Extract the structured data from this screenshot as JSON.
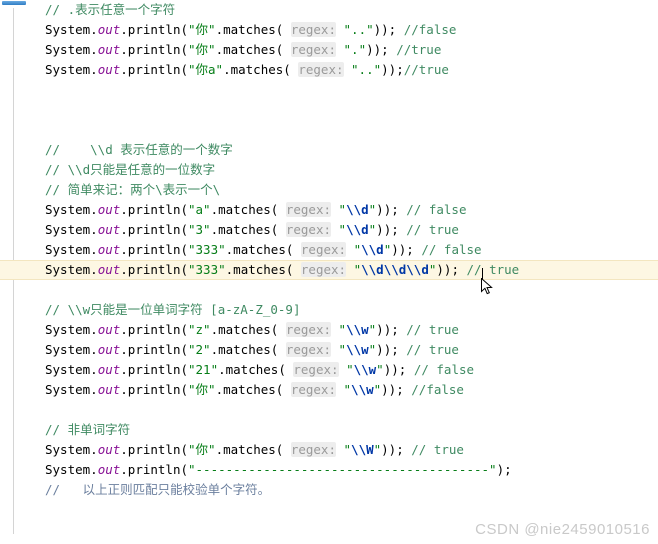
{
  "app": {
    "kind": "code-editor",
    "language": "Java",
    "background_color": "#ffffff",
    "highlight_line_color": "#fdf7e3",
    "accent_color": "#2f7dc4"
  },
  "colors": {
    "plain": "#000000",
    "field": "#871094",
    "string": "#067d17",
    "regex_escape": "#0037a6",
    "comment": "#3f8a62",
    "comment_blue": "#6b7f9e",
    "param_hint": "#9a9a9a",
    "param_hint_bg": "#ededed",
    "gutter_divider": "#d4d4d4",
    "watermark": "#c9c9c9"
  },
  "editor": {
    "caret": {
      "visible": true,
      "line_index": 13
    },
    "mouse_pointer": {
      "visible": true,
      "glyph": "arrow-cursor"
    },
    "lines": [
      {
        "highlighted": false,
        "tokens": [
          {
            "t": "comment",
            "s": "// .表示任意一个字符"
          }
        ]
      },
      {
        "highlighted": false,
        "tokens": [
          {
            "t": "plain",
            "s": "System."
          },
          {
            "t": "field",
            "s": "out"
          },
          {
            "t": "plain",
            "s": ".println("
          },
          {
            "t": "string",
            "s": "\"你\""
          },
          {
            "t": "plain",
            "s": ".matches( "
          },
          {
            "t": "hint",
            "s": "regex:"
          },
          {
            "t": "plain",
            "s": " "
          },
          {
            "t": "string",
            "s": "\"..\""
          },
          {
            "t": "plain",
            "s": ")); "
          },
          {
            "t": "comment",
            "s": "//false"
          }
        ]
      },
      {
        "highlighted": false,
        "tokens": [
          {
            "t": "plain",
            "s": "System."
          },
          {
            "t": "field",
            "s": "out"
          },
          {
            "t": "plain",
            "s": ".println("
          },
          {
            "t": "string",
            "s": "\"你\""
          },
          {
            "t": "plain",
            "s": ".matches( "
          },
          {
            "t": "hint",
            "s": "regex:"
          },
          {
            "t": "plain",
            "s": " "
          },
          {
            "t": "string",
            "s": "\".\""
          },
          {
            "t": "plain",
            "s": ")); "
          },
          {
            "t": "comment",
            "s": "//true"
          }
        ]
      },
      {
        "highlighted": false,
        "tokens": [
          {
            "t": "plain",
            "s": "System."
          },
          {
            "t": "field",
            "s": "out"
          },
          {
            "t": "plain",
            "s": ".println("
          },
          {
            "t": "string",
            "s": "\"你a\""
          },
          {
            "t": "plain",
            "s": ".matches( "
          },
          {
            "t": "hint",
            "s": "regex:"
          },
          {
            "t": "plain",
            "s": " "
          },
          {
            "t": "string",
            "s": "\"..\""
          },
          {
            "t": "plain",
            "s": "));"
          },
          {
            "t": "comment",
            "s": "//true"
          }
        ]
      },
      {
        "highlighted": false,
        "tokens": []
      },
      {
        "highlighted": false,
        "tokens": []
      },
      {
        "highlighted": false,
        "tokens": []
      },
      {
        "highlighted": false,
        "tokens": [
          {
            "t": "comment",
            "s": "//    \\\\d 表示任意的一个数字"
          }
        ]
      },
      {
        "highlighted": false,
        "tokens": [
          {
            "t": "comment",
            "s": "// \\\\d只能是任意的一位数字"
          }
        ]
      },
      {
        "highlighted": false,
        "tokens": [
          {
            "t": "comment",
            "s": "// 简单来记：两个\\表示一个\\"
          }
        ]
      },
      {
        "highlighted": false,
        "tokens": [
          {
            "t": "plain",
            "s": "System."
          },
          {
            "t": "field",
            "s": "out"
          },
          {
            "t": "plain",
            "s": ".println("
          },
          {
            "t": "string",
            "s": "\"a\""
          },
          {
            "t": "plain",
            "s": ".matches( "
          },
          {
            "t": "hint",
            "s": "regex:"
          },
          {
            "t": "plain",
            "s": " "
          },
          {
            "t": "string",
            "s": "\""
          },
          {
            "t": "regex",
            "s": "\\\\d"
          },
          {
            "t": "string",
            "s": "\""
          },
          {
            "t": "plain",
            "s": ")); "
          },
          {
            "t": "comment",
            "s": "// false"
          }
        ]
      },
      {
        "highlighted": false,
        "tokens": [
          {
            "t": "plain",
            "s": "System."
          },
          {
            "t": "field",
            "s": "out"
          },
          {
            "t": "plain",
            "s": ".println("
          },
          {
            "t": "string",
            "s": "\"3\""
          },
          {
            "t": "plain",
            "s": ".matches( "
          },
          {
            "t": "hint",
            "s": "regex:"
          },
          {
            "t": "plain",
            "s": " "
          },
          {
            "t": "string",
            "s": "\""
          },
          {
            "t": "regex",
            "s": "\\\\d"
          },
          {
            "t": "string",
            "s": "\""
          },
          {
            "t": "plain",
            "s": ")); "
          },
          {
            "t": "comment",
            "s": "// true"
          }
        ]
      },
      {
        "highlighted": false,
        "tokens": [
          {
            "t": "plain",
            "s": "System."
          },
          {
            "t": "field",
            "s": "out"
          },
          {
            "t": "plain",
            "s": ".println("
          },
          {
            "t": "string",
            "s": "\"333\""
          },
          {
            "t": "plain",
            "s": ".matches( "
          },
          {
            "t": "hint",
            "s": "regex:"
          },
          {
            "t": "plain",
            "s": " "
          },
          {
            "t": "string",
            "s": "\""
          },
          {
            "t": "regex",
            "s": "\\\\d"
          },
          {
            "t": "string",
            "s": "\""
          },
          {
            "t": "plain",
            "s": ")); "
          },
          {
            "t": "comment",
            "s": "// false"
          }
        ]
      },
      {
        "highlighted": true,
        "tokens": [
          {
            "t": "plain",
            "s": "System."
          },
          {
            "t": "field",
            "s": "out"
          },
          {
            "t": "plain",
            "s": ".println("
          },
          {
            "t": "string",
            "s": "\"333\""
          },
          {
            "t": "plain",
            "s": ".matches( "
          },
          {
            "t": "hint",
            "s": "regex:"
          },
          {
            "t": "plain",
            "s": " "
          },
          {
            "t": "string",
            "s": "\""
          },
          {
            "t": "regex",
            "s": "\\\\d\\\\d\\\\d"
          },
          {
            "t": "string",
            "s": "\""
          },
          {
            "t": "plain",
            "s": ")); "
          },
          {
            "t": "comment",
            "s": "// true"
          }
        ]
      },
      {
        "highlighted": false,
        "tokens": []
      },
      {
        "highlighted": false,
        "tokens": [
          {
            "t": "comment",
            "s": "// \\\\w只能是一位单词字符 [a-zA-Z_0-9]"
          }
        ]
      },
      {
        "highlighted": false,
        "tokens": [
          {
            "t": "plain",
            "s": "System."
          },
          {
            "t": "field",
            "s": "out"
          },
          {
            "t": "plain",
            "s": ".println("
          },
          {
            "t": "string",
            "s": "\"z\""
          },
          {
            "t": "plain",
            "s": ".matches( "
          },
          {
            "t": "hint",
            "s": "regex:"
          },
          {
            "t": "plain",
            "s": " "
          },
          {
            "t": "string",
            "s": "\""
          },
          {
            "t": "regex",
            "s": "\\\\w"
          },
          {
            "t": "string",
            "s": "\""
          },
          {
            "t": "plain",
            "s": ")); "
          },
          {
            "t": "comment",
            "s": "// true"
          }
        ]
      },
      {
        "highlighted": false,
        "tokens": [
          {
            "t": "plain",
            "s": "System."
          },
          {
            "t": "field",
            "s": "out"
          },
          {
            "t": "plain",
            "s": ".println("
          },
          {
            "t": "string",
            "s": "\"2\""
          },
          {
            "t": "plain",
            "s": ".matches( "
          },
          {
            "t": "hint",
            "s": "regex:"
          },
          {
            "t": "plain",
            "s": " "
          },
          {
            "t": "string",
            "s": "\""
          },
          {
            "t": "regex",
            "s": "\\\\w"
          },
          {
            "t": "string",
            "s": "\""
          },
          {
            "t": "plain",
            "s": ")); "
          },
          {
            "t": "comment",
            "s": "// true"
          }
        ]
      },
      {
        "highlighted": false,
        "tokens": [
          {
            "t": "plain",
            "s": "System."
          },
          {
            "t": "field",
            "s": "out"
          },
          {
            "t": "plain",
            "s": ".println("
          },
          {
            "t": "string",
            "s": "\"21\""
          },
          {
            "t": "plain",
            "s": ".matches( "
          },
          {
            "t": "hint",
            "s": "regex:"
          },
          {
            "t": "plain",
            "s": " "
          },
          {
            "t": "string",
            "s": "\""
          },
          {
            "t": "regex",
            "s": "\\\\w"
          },
          {
            "t": "string",
            "s": "\""
          },
          {
            "t": "plain",
            "s": ")); "
          },
          {
            "t": "comment",
            "s": "// false"
          }
        ]
      },
      {
        "highlighted": false,
        "tokens": [
          {
            "t": "plain",
            "s": "System."
          },
          {
            "t": "field",
            "s": "out"
          },
          {
            "t": "plain",
            "s": ".println("
          },
          {
            "t": "string",
            "s": "\"你\""
          },
          {
            "t": "plain",
            "s": ".matches( "
          },
          {
            "t": "hint",
            "s": "regex:"
          },
          {
            "t": "plain",
            "s": " "
          },
          {
            "t": "string",
            "s": "\""
          },
          {
            "t": "regex",
            "s": "\\\\w"
          },
          {
            "t": "string",
            "s": "\""
          },
          {
            "t": "plain",
            "s": ")); "
          },
          {
            "t": "comment",
            "s": "//false"
          }
        ]
      },
      {
        "highlighted": false,
        "tokens": []
      },
      {
        "highlighted": false,
        "tokens": [
          {
            "t": "comment",
            "s": "// 非单词字符"
          }
        ]
      },
      {
        "highlighted": false,
        "tokens": [
          {
            "t": "plain",
            "s": "System."
          },
          {
            "t": "field",
            "s": "out"
          },
          {
            "t": "plain",
            "s": ".println("
          },
          {
            "t": "string",
            "s": "\"你\""
          },
          {
            "t": "plain",
            "s": ".matches( "
          },
          {
            "t": "hint",
            "s": "regex:"
          },
          {
            "t": "plain",
            "s": " "
          },
          {
            "t": "string",
            "s": "\""
          },
          {
            "t": "regex",
            "s": "\\\\W"
          },
          {
            "t": "string",
            "s": "\""
          },
          {
            "t": "plain",
            "s": ")); "
          },
          {
            "t": "comment",
            "s": "// true"
          }
        ]
      },
      {
        "highlighted": false,
        "tokens": [
          {
            "t": "plain",
            "s": "System."
          },
          {
            "t": "field",
            "s": "out"
          },
          {
            "t": "plain",
            "s": ".println("
          },
          {
            "t": "string",
            "s": "\"---------------------------------------\""
          },
          {
            "t": "plain",
            "s": ");"
          }
        ]
      },
      {
        "highlighted": false,
        "tokens": [
          {
            "t": "comment_blue",
            "s": "//   以上正则匹配只能校验单个字符。"
          }
        ]
      }
    ]
  },
  "watermark": {
    "text": "CSDN @nie2459010516"
  }
}
